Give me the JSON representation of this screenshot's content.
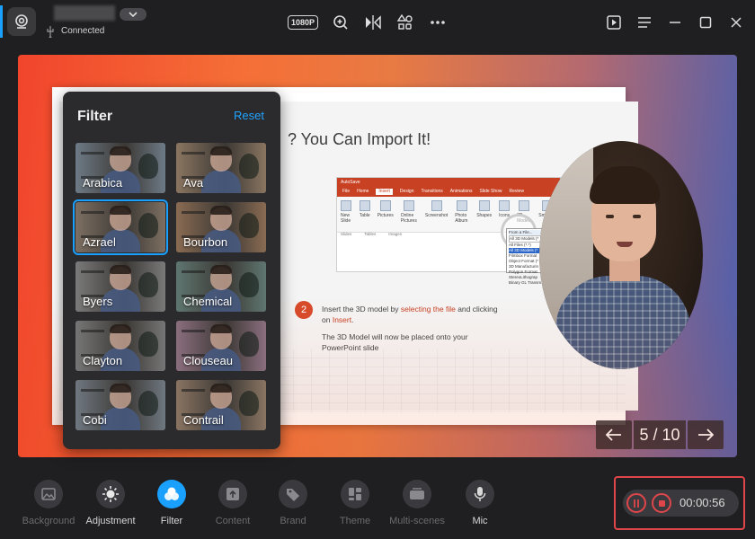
{
  "device": {
    "status": "Connected"
  },
  "toolbar": {
    "resolution": "1080P",
    "icons": [
      "zoom-in-icon",
      "mirror-icon",
      "layout-icon",
      "more-icon",
      "present-icon",
      "menu-icon",
      "minimize-icon",
      "maximize-icon",
      "close-icon"
    ]
  },
  "slide": {
    "title": "? You Can Import It!",
    "ppt": {
      "app_label": "AutoSave",
      "tabs": [
        "File",
        "Home",
        "Insert",
        "Design",
        "Transitions",
        "Animations",
        "Slide Show",
        "Review"
      ],
      "active_tab": "Insert",
      "ribbon": [
        "New Slide",
        "Table",
        "Pictures",
        "Online Pictures",
        "Screenshot",
        "Photo Album",
        "Shapes",
        "Icons",
        "3D Models",
        "SmartArt"
      ],
      "ribbon_groups": [
        "Slides",
        "Tables",
        "Images"
      ],
      "dropdown_header": "From a File...",
      "dropdown_field": "All 3D Models (*",
      "dropdown_items": [
        "All Files (*.*)",
        "All 3D Models (*",
        "Filmbox Format",
        "Object Format (*",
        "3D Manufacturin",
        "Polygon Format",
        "StereoLithograp",
        "Binary GL Transm"
      ],
      "dropdown_selected_index": 1
    },
    "step_number": "2",
    "step_text_pre": "Insert the 3D model by ",
    "step_text_hl1": "selecting the file",
    "step_text_mid": " and clicking on ",
    "step_text_hl2": "Insert",
    "step_text_post": ".",
    "step_text_2": "The 3D Model will now be placed onto your PowerPoint slide"
  },
  "pager": {
    "count": "5 / 10"
  },
  "filter": {
    "title": "Filter",
    "reset": "Reset",
    "selected": "Azrael",
    "items": [
      {
        "label": "Arabica",
        "tint": "#6d7a86"
      },
      {
        "label": "Ava",
        "tint": "#8a7560"
      },
      {
        "label": "Azrael",
        "tint": "#7d6f62"
      },
      {
        "label": "Bourbon",
        "tint": "#8a6b52"
      },
      {
        "label": "Byers",
        "tint": "#7a7a7a"
      },
      {
        "label": "Chemical",
        "tint": "#5f7670"
      },
      {
        "label": "Clayton",
        "tint": "#767676"
      },
      {
        "label": "Clouseau",
        "tint": "#8b6e7e"
      },
      {
        "label": "Cobi",
        "tint": "#6f7780"
      },
      {
        "label": "Contrail",
        "tint": "#8a7462"
      }
    ]
  },
  "bottombar": {
    "items": [
      {
        "label": "Background",
        "icon": "image-icon"
      },
      {
        "label": "Adjustment",
        "icon": "brightness-icon"
      },
      {
        "label": "Filter",
        "icon": "filter-icon"
      },
      {
        "label": "Content",
        "icon": "upload-icon"
      },
      {
        "label": "Brand",
        "icon": "tag-icon"
      },
      {
        "label": "Theme",
        "icon": "theme-icon"
      },
      {
        "label": "Multi-scenes",
        "icon": "scenes-icon"
      },
      {
        "label": "Mic",
        "icon": "mic-icon"
      }
    ],
    "active": "Filter"
  },
  "recording": {
    "time": "00:00:56",
    "accent": "#e0454a"
  },
  "colors": {
    "accent": "#1aa0ff",
    "background": "#1f1f21"
  }
}
